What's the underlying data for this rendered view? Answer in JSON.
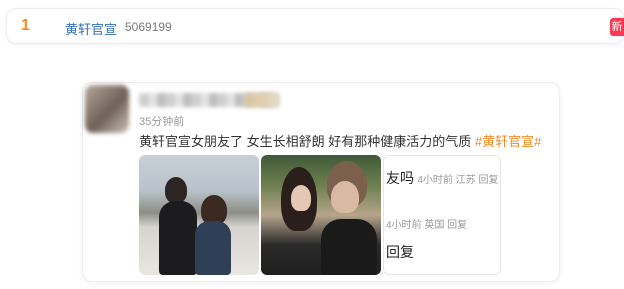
{
  "trending": {
    "rank": "1",
    "topic": "黄轩官宣",
    "heat": "5069199",
    "badge": "新",
    "badge_color": "#ff3852"
  },
  "post": {
    "time": "35分钟前",
    "text_main": "黄轩官宣女朋友了 女生长相舒朗 好有那种健康活力的气质 ",
    "hashtag": "#黄轩官宣#",
    "photo_count": 2
  },
  "comment_overlay": {
    "line1_text": "友吗",
    "line1_meta": "4小时前 江苏 回复",
    "line2_meta": "4小时前 英国 回复",
    "line3_text": "回复"
  },
  "colors": {
    "rank": "#f28c2a",
    "topic": "#2e6fb6",
    "hashtag": "#f08a24"
  }
}
